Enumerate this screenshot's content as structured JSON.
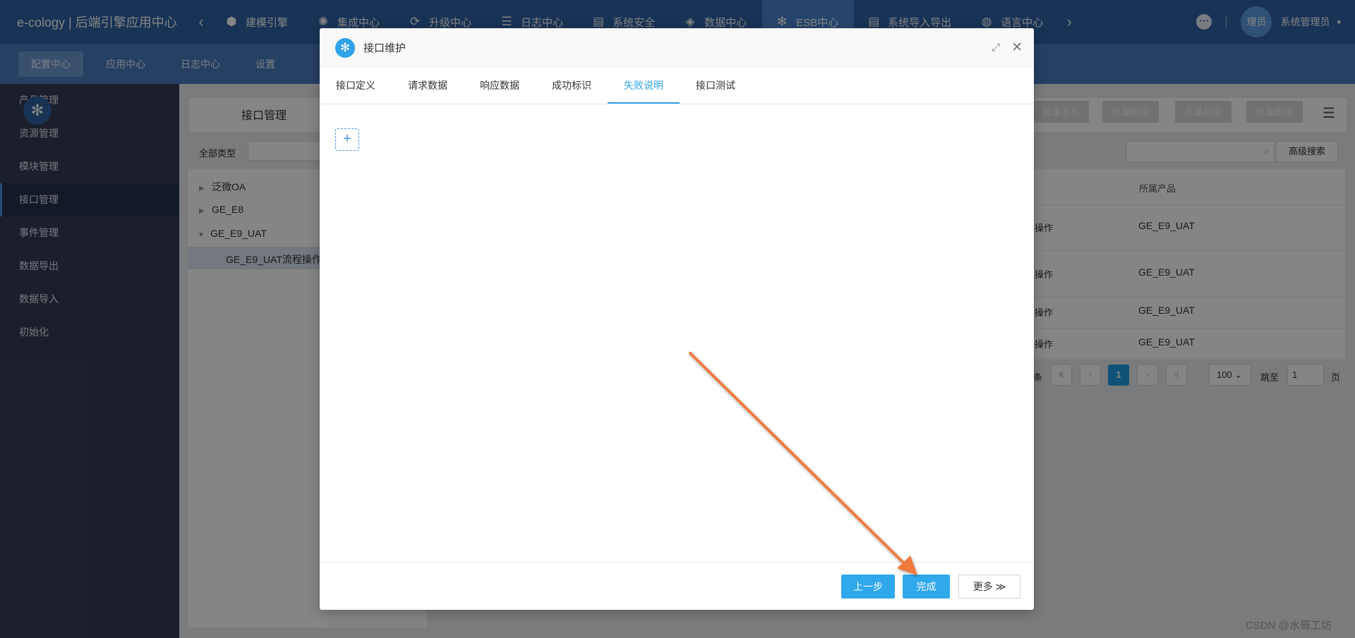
{
  "topbar": {
    "brand": "e-cology | 后端引擎应用中心",
    "prev_arrow": "‹",
    "next_arrow": "›",
    "items": [
      {
        "label": "建模引擎",
        "icon": "cube-icon",
        "glyph": "⬢"
      },
      {
        "label": "集成中心",
        "icon": "network-icon",
        "glyph": "✺"
      },
      {
        "label": "升级中心",
        "icon": "refresh-icon",
        "glyph": "⟳"
      },
      {
        "label": "日志中心",
        "icon": "log-icon",
        "glyph": "☰"
      },
      {
        "label": "系统安全",
        "icon": "document-icon",
        "glyph": "▤"
      },
      {
        "label": "数据中心",
        "icon": "layers-icon",
        "glyph": "◈"
      },
      {
        "label": "ESB中心",
        "icon": "esb-icon",
        "glyph": "✻"
      },
      {
        "label": "系统导入导出",
        "icon": "file-icon",
        "glyph": "▤"
      },
      {
        "label": "语言中心",
        "icon": "globe-icon",
        "glyph": "◍"
      }
    ],
    "active_index": 6,
    "avatar_text": "理员",
    "username": "系统管理员",
    "user_caret": "▾",
    "more_glyph": "···"
  },
  "subbar": {
    "items": [
      "配置中心",
      "应用中心",
      "日志中心",
      "设置"
    ],
    "active_index": 0
  },
  "sidemenu": {
    "items": [
      "产品管理",
      "资源管理",
      "模块管理",
      "接口管理",
      "事件管理",
      "数据导出",
      "数据导入",
      "初始化"
    ],
    "active_index": 3
  },
  "main": {
    "title": "接口管理",
    "logo_glyph": "✻",
    "type_label": "全部类型",
    "tree": [
      {
        "label": "泛微OA",
        "caret": "▶"
      },
      {
        "label": "GE_E8",
        "caret": "▶"
      },
      {
        "label": "GE_E9_UAT",
        "caret": "▼"
      },
      {
        "label": "GE_E9_UAT流程操作",
        "caret": ""
      }
    ],
    "bulk_buttons": [
      "批量发布",
      "批量撤回",
      "批量封存",
      "批量删除"
    ],
    "list_glyph": "☰",
    "search_glyph": "⌕",
    "advanced_search": "高级搜索",
    "column_product": "所属产品",
    "rows": [
      {
        "op": "操作",
        "product": "GE_E9_UAT"
      },
      {
        "op": "操作",
        "product": "GE_E9_UAT"
      },
      {
        "op": "操作",
        "product": "GE_E9_UAT"
      },
      {
        "op": "操作",
        "product": "GE_E9_UAT"
      }
    ],
    "pager": {
      "total_suffix": "条",
      "first": "K",
      "prev": "‹",
      "current": "1",
      "next": "›",
      "last": "›|",
      "page_size": "100 ⌄",
      "jump_label": "跳至",
      "jump_value": "1",
      "page_unit": "页"
    }
  },
  "modal": {
    "title": "接口维护",
    "logo_glyph": "✻",
    "expand_glyph": "⤢",
    "close_glyph": "✕",
    "tabs": [
      "接口定义",
      "请求数据",
      "响应数据",
      "成功标识",
      "失败说明",
      "接口测试"
    ],
    "active_tab": 4,
    "add_glyph": "+",
    "buttons": {
      "prev": "上一步",
      "done": "完成",
      "more": "更多 ≫"
    }
  },
  "annotation": {
    "arrow_color": "#f07a3c"
  },
  "watermark": "CSDN @水哥工坊"
}
